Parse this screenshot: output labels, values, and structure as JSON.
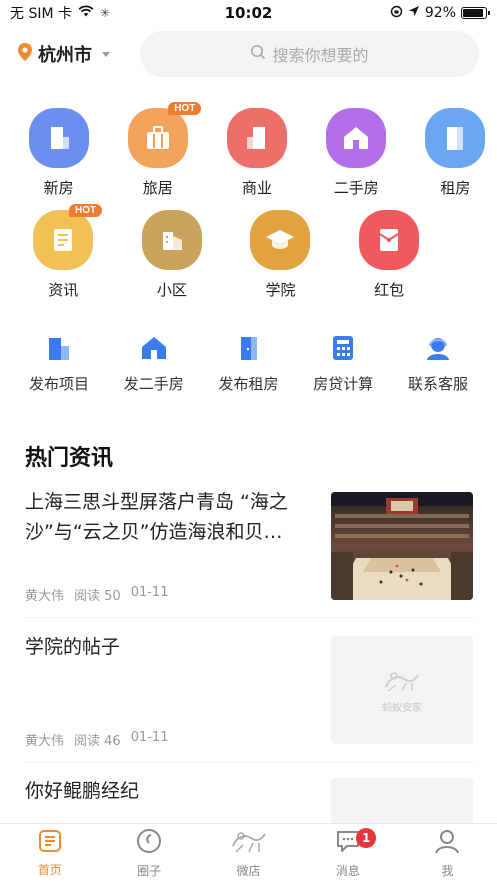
{
  "status_bar": {
    "carrier": "无 SIM 卡",
    "time": "10:02",
    "battery": "92%",
    "battery_level": 0.92
  },
  "header": {
    "city": "杭州市",
    "search_placeholder": "搜索你想要的"
  },
  "hot_badge": "HOT",
  "categories_row1": [
    {
      "label": "新房",
      "icon": "building-icon",
      "color": "#6b8ff0",
      "hot": false
    },
    {
      "label": "旅居",
      "icon": "suitcase-icon",
      "color": "#f2a25b",
      "hot": true
    },
    {
      "label": "商业",
      "icon": "office-icon",
      "color": "#ec6f6a",
      "hot": false
    },
    {
      "label": "二手房",
      "icon": "house-icon",
      "color": "#b46ee8",
      "hot": false
    },
    {
      "label": "租房",
      "icon": "door-icon",
      "color": "#6aa6f2",
      "hot": false
    }
  ],
  "categories_row2": [
    {
      "label": "资讯",
      "icon": "news-icon",
      "color": "#f1c155",
      "hot": true
    },
    {
      "label": "小区",
      "icon": "community-icon",
      "color": "#c9a35c",
      "hot": false
    },
    {
      "label": "学院",
      "icon": "graduation-cap-icon",
      "color": "#e1a23f",
      "hot": false
    },
    {
      "label": "红包",
      "icon": "red-envelope-icon",
      "color": "#ee5a5e",
      "hot": false
    }
  ],
  "quick_links": [
    {
      "label": "发布项目",
      "icon": "publish-project-icon"
    },
    {
      "label": "发二手房",
      "icon": "house-icon"
    },
    {
      "label": "发布租房",
      "icon": "door-icon"
    },
    {
      "label": "房贷计算",
      "icon": "calculator-icon"
    },
    {
      "label": "联系客服",
      "icon": "customer-service-icon"
    }
  ],
  "news": {
    "section_title": "热门资讯",
    "items": [
      {
        "title": "上海三思斗型屏落户青岛 “海之沙”与“云之贝”仿造海浪和贝…",
        "author": "黄大伟",
        "reads": "阅读 50",
        "date": "01-11",
        "thumb": "stadium"
      },
      {
        "title": "学院的帖子",
        "author": "黄大伟",
        "reads": "阅读 46",
        "date": "01-11",
        "thumb": "placeholder",
        "placeholder_text": "蚂蚁安家"
      },
      {
        "title": "你好鲲鹏经纪",
        "author": "",
        "reads": "",
        "date": "",
        "thumb": "placeholder"
      }
    ]
  },
  "tabbar": [
    {
      "label": "首页",
      "icon": "home-tab-icon",
      "active": true
    },
    {
      "label": "圈子",
      "icon": "circle-tab-icon",
      "active": false
    },
    {
      "label": "微店",
      "icon": "ant-logo-icon",
      "active": false
    },
    {
      "label": "消息",
      "icon": "message-tab-icon",
      "active": false,
      "badge": "1"
    },
    {
      "label": "我",
      "icon": "profile-tab-icon",
      "active": false
    }
  ],
  "colors": {
    "accent": "#f08a2e",
    "badge": "#e8353d",
    "quick_icon": "#3a7bf0"
  }
}
